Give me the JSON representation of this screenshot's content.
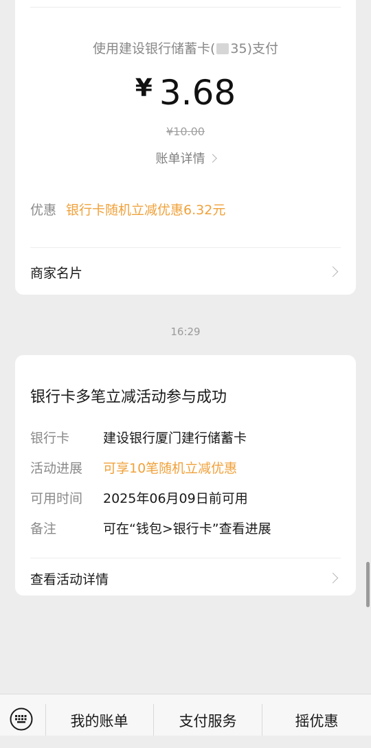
{
  "payment": {
    "pay_method": "使用建设银行储蓄卡(",
    "pay_method_end": "35)支付",
    "currency": "¥",
    "amount": "3.68",
    "original_amount": "¥10.00",
    "bill_details_link": "账单详情"
  },
  "discount": {
    "label": "优惠",
    "value": "银行卡随机立减优惠6.32元"
  },
  "merchant_card": {
    "label": "商家名片"
  },
  "timestamp": "16:29",
  "activity_card": {
    "title": "银行卡多笔立减活动参与成功",
    "rows": [
      {
        "key": "银行卡",
        "value": "建设银行厦门建行储蓄卡"
      },
      {
        "key": "活动进展",
        "value": "可享10笔随机立减优惠"
      },
      {
        "key": "可用时间",
        "value": "2025年06月09日前可用"
      },
      {
        "key": "备注",
        "value": "可在“钱包>银行卡”查看进展"
      }
    ],
    "details_link": "查看活动详情"
  },
  "bottom_menu": {
    "keyboard_icon": "keyboard-icon",
    "items": [
      "我的账单",
      "支付服务",
      "摇优惠"
    ]
  },
  "colors": {
    "accent_orange": "#f0a13a",
    "background": "#ededed",
    "card": "#ffffff"
  }
}
